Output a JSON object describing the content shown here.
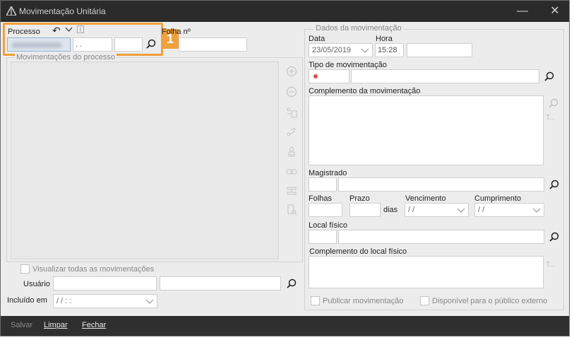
{
  "window": {
    "title": "Movimentação Unitária",
    "minimize_glyph": "—",
    "close_glyph": "✕"
  },
  "processo": {
    "label": "Processo",
    "undo_glyph": "↶",
    "chevron_glyph": "⌄",
    "number_value": "",
    "field2_value": ". .",
    "field3_value": "",
    "badge": "1"
  },
  "folha": {
    "label": "Folha nº",
    "value": ""
  },
  "movimentacoes_processo": {
    "group_label": "Movimentações do processo"
  },
  "visualizar_todas": {
    "label": "Visualizar todas as movimentações",
    "checked": false
  },
  "usuario": {
    "label": "Usuário",
    "value1": "",
    "value2": ""
  },
  "incluido_em": {
    "label": "Incluído em",
    "value": "/ /      : :"
  },
  "dados": {
    "group_label": "Dados da movimentação",
    "data_label": "Data",
    "data_value": "23/05/2019",
    "hora_label": "Hora",
    "hora_value": "15:28",
    "hora_extra_value": "",
    "tipo_label": "Tipo de movimentação",
    "tipo_code": "",
    "tipo_desc": "",
    "complemento_label": "Complemento da movimentação",
    "side_t": "T...",
    "magistrado_label": "Magistrado",
    "magistrado_code": "",
    "magistrado_name": "",
    "folhas_label": "Folhas",
    "folhas_value": "",
    "prazo_label": "Prazo",
    "prazo_value": "",
    "dias_label": "dias",
    "vencimento_label": "Vencimento",
    "vencimento_value": "/ /",
    "cumprimento_label": "Cumprimento",
    "cumprimento_value": "/ /",
    "local_label": "Local físico",
    "local_code": "",
    "local_name": "",
    "complemento_local_label": "Complemento do local físico",
    "side_t2": "T...",
    "publicar_label": "Publicar movimentação",
    "disponivel_label": "Disponível para o público externo"
  },
  "footer": {
    "salvar": "Salvar",
    "limpar": "Limpar",
    "fechar": "Fechar"
  },
  "colors": {
    "titlebar": "#2b2b2b",
    "footer": "#2f2f2f",
    "highlight": "#f0a03c",
    "required_dot": "#d9534f"
  }
}
